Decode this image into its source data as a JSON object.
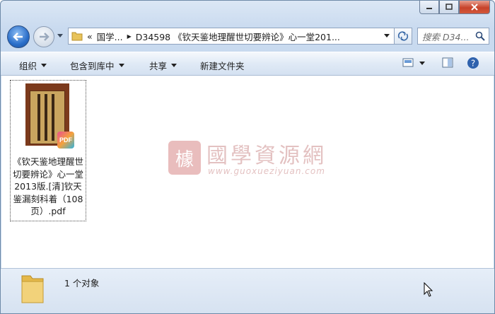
{
  "window": {
    "controls": {
      "minimize_icon": "minimize-icon",
      "maximize_icon": "maximize-icon",
      "close_icon": "close-icon"
    }
  },
  "address": {
    "overflow": "«",
    "crumbs": [
      "国学...",
      "D34598 《钦天鉴地理醒世切要辨论》心一堂201..."
    ]
  },
  "search": {
    "placeholder": "搜索 D34..."
  },
  "toolbar": {
    "organize": "组织",
    "include_library": "包含到库中",
    "share": "共享",
    "new_folder": "新建文件夹"
  },
  "files": [
    {
      "name": "《钦天鉴地理醒世切要辨论》心一堂2013版.[清]钦天鉴漏刻科着（108页）.pdf",
      "badge": "PDF"
    }
  ],
  "watermark": {
    "title": "國學資源網",
    "url": "www.guoxueziyuan.com",
    "seal": "㯫"
  },
  "status": {
    "count": "1 个对象"
  },
  "colors": {
    "accent": "#2a6ec9",
    "close": "#c7432a",
    "watermark": "#c98585"
  }
}
